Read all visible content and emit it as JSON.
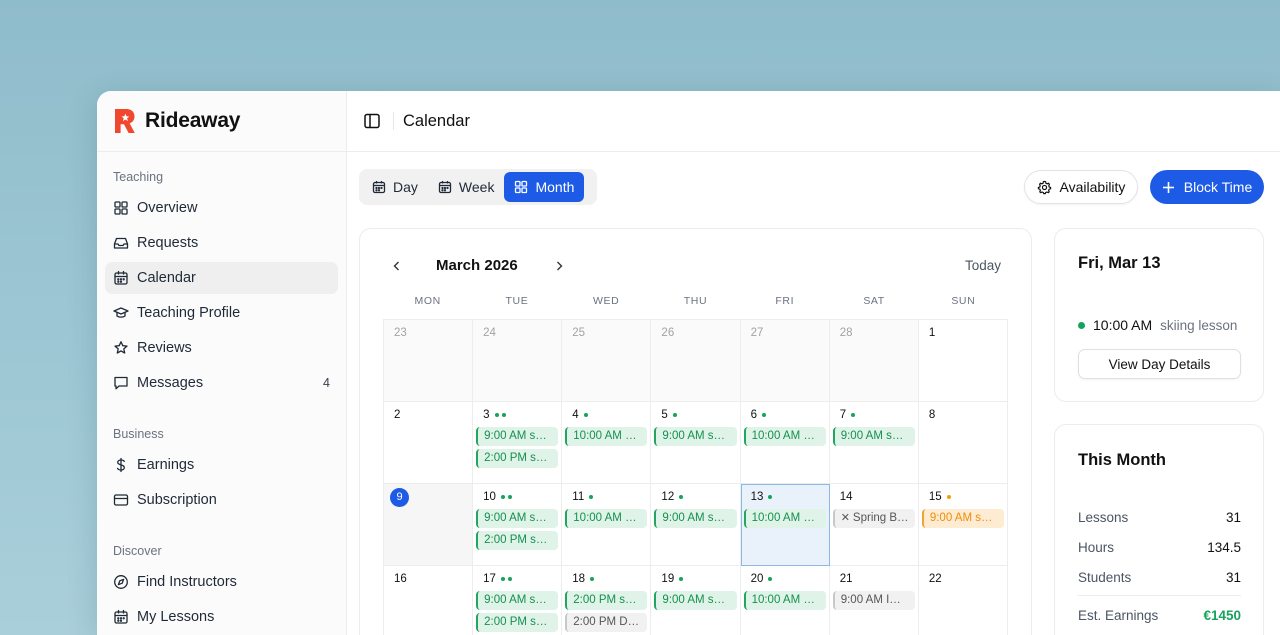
{
  "brand": {
    "name": "Rideaway"
  },
  "header": {
    "title": "Calendar"
  },
  "sidebar": {
    "sections": [
      {
        "heading": "Teaching",
        "items": [
          {
            "label": "Overview",
            "icon": "grid-icon"
          },
          {
            "label": "Requests",
            "icon": "inbox-icon"
          },
          {
            "label": "Calendar",
            "icon": "calendar-icon",
            "active": true
          },
          {
            "label": "Teaching Profile",
            "icon": "graduation-cap-icon"
          },
          {
            "label": "Reviews",
            "icon": "star-icon"
          },
          {
            "label": "Messages",
            "icon": "message-icon",
            "badge": "4"
          }
        ]
      },
      {
        "heading": "Business",
        "items": [
          {
            "label": "Earnings",
            "icon": "dollar-icon"
          },
          {
            "label": "Subscription",
            "icon": "credit-card-icon"
          }
        ]
      },
      {
        "heading": "Discover",
        "items": [
          {
            "label": "Find Instructors",
            "icon": "compass-icon"
          },
          {
            "label": "My Lessons",
            "icon": "calendar-icon"
          }
        ]
      }
    ]
  },
  "toolbar": {
    "views": [
      "Day",
      "Week",
      "Month"
    ],
    "active_view": "Month",
    "availability_label": "Availability",
    "block_time_label": "Block Time"
  },
  "calendar": {
    "month_label": "March 2026",
    "today_label": "Today",
    "weekdays": [
      "MON",
      "TUE",
      "WED",
      "THU",
      "FRI",
      "SAT",
      "SUN"
    ],
    "days": [
      {
        "n": "23",
        "muted": true,
        "events": []
      },
      {
        "n": "24",
        "muted": true,
        "events": []
      },
      {
        "n": "25",
        "muted": true,
        "events": []
      },
      {
        "n": "26",
        "muted": true,
        "events": []
      },
      {
        "n": "27",
        "muted": true,
        "events": []
      },
      {
        "n": "28",
        "muted": true,
        "events": []
      },
      {
        "n": "1",
        "events": []
      },
      {
        "n": "2",
        "events": []
      },
      {
        "n": "3",
        "dots": [
          "green",
          "green"
        ],
        "events": [
          {
            "text": "9:00 AM s…"
          },
          {
            "text": "2:00 PM s…"
          }
        ]
      },
      {
        "n": "4",
        "dots": [
          "green"
        ],
        "events": [
          {
            "text": "10:00 AM …"
          }
        ]
      },
      {
        "n": "5",
        "dots": [
          "green"
        ],
        "events": [
          {
            "text": "9:00 AM s…"
          }
        ]
      },
      {
        "n": "6",
        "dots": [
          "green"
        ],
        "events": [
          {
            "text": "10:00 AM …"
          }
        ]
      },
      {
        "n": "7",
        "dots": [
          "green"
        ],
        "events": [
          {
            "text": "9:00 AM s…"
          }
        ]
      },
      {
        "n": "8",
        "events": []
      },
      {
        "n": "9",
        "today": true,
        "events": []
      },
      {
        "n": "10",
        "dots": [
          "green",
          "green"
        ],
        "events": [
          {
            "text": "9:00 AM s…"
          },
          {
            "text": "2:00 PM s…"
          }
        ]
      },
      {
        "n": "11",
        "dots": [
          "green"
        ],
        "events": [
          {
            "text": "10:00 AM …"
          }
        ]
      },
      {
        "n": "12",
        "dots": [
          "green"
        ],
        "events": [
          {
            "text": "9:00 AM s…"
          }
        ]
      },
      {
        "n": "13",
        "selected": true,
        "dots": [
          "green"
        ],
        "events": [
          {
            "text": "10:00 AM …"
          }
        ]
      },
      {
        "n": "14",
        "events": [
          {
            "text": "Spring B…",
            "kind": "gray",
            "x": true
          }
        ]
      },
      {
        "n": "15",
        "dots": [
          "orange"
        ],
        "events": [
          {
            "text": "9:00 AM s…",
            "kind": "orange"
          }
        ]
      },
      {
        "n": "16",
        "events": []
      },
      {
        "n": "17",
        "dots": [
          "green",
          "green"
        ],
        "events": [
          {
            "text": "9:00 AM s…"
          },
          {
            "text": "2:00 PM s…"
          }
        ]
      },
      {
        "n": "18",
        "dots": [
          "green"
        ],
        "events": [
          {
            "text": "2:00 PM s…"
          },
          {
            "text": "2:00 PM D…",
            "kind": "gray"
          }
        ]
      },
      {
        "n": "19",
        "dots": [
          "green"
        ],
        "events": [
          {
            "text": "9:00 AM s…"
          }
        ]
      },
      {
        "n": "20",
        "dots": [
          "green"
        ],
        "events": [
          {
            "text": "10:00 AM …"
          }
        ]
      },
      {
        "n": "21",
        "events": [
          {
            "text": "9:00 AM I…",
            "kind": "gray"
          }
        ]
      },
      {
        "n": "22",
        "events": []
      }
    ]
  },
  "day_panel": {
    "title": "Fri, Mar 13",
    "event_time": "10:00 AM",
    "event_label": "skiing lesson",
    "button_label": "View Day Details"
  },
  "month_panel": {
    "title": "This Month",
    "stats": [
      {
        "label": "Lessons",
        "value": "31"
      },
      {
        "label": "Hours",
        "value": "134.5"
      },
      {
        "label": "Students",
        "value": "31"
      },
      {
        "label": "Est. Earnings",
        "value": "€1450",
        "accent": true
      }
    ]
  },
  "colors": {
    "accent": "#1d5be6",
    "success": "#16a35b",
    "warning": "#f59e0b",
    "brand": "#f0472e"
  }
}
